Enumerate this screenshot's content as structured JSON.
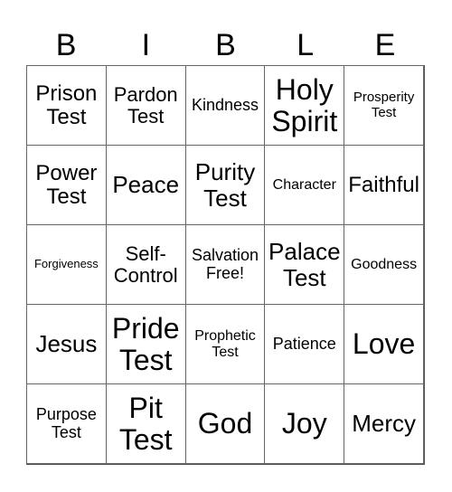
{
  "header": [
    "B",
    "I",
    "B",
    "L",
    "E"
  ],
  "cells": [
    [
      "Prison Test",
      "Pardon Test",
      "Kindness",
      "Holy Spirit",
      "Prosperity Test"
    ],
    [
      "Power Test",
      "Peace",
      "Purity Test",
      "Character",
      "Faithful"
    ],
    [
      "Forgiveness",
      "Self-Control",
      "Salvation Free!",
      "Palace Test",
      "Goodness"
    ],
    [
      "Jesus",
      "Pride Test",
      "Prophetic Test",
      "Patience",
      "Love"
    ],
    [
      "Purpose Test",
      "Pit Test",
      "God",
      "Joy",
      "Mercy"
    ]
  ]
}
